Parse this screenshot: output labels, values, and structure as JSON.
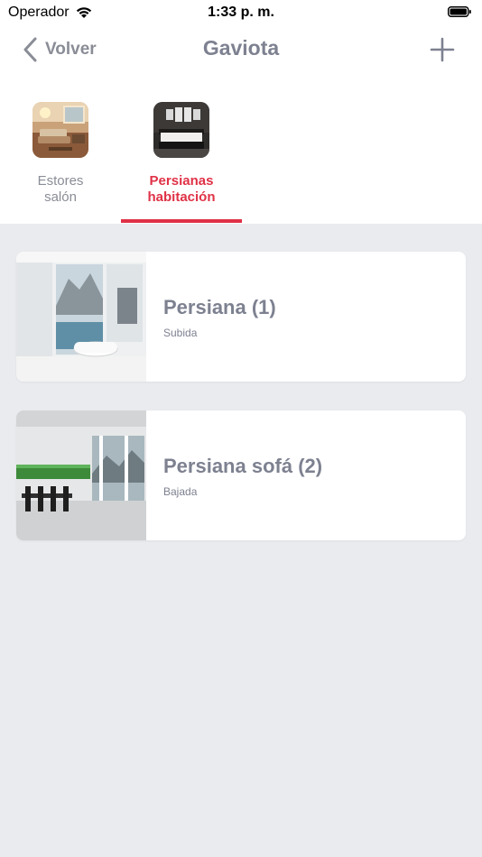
{
  "status_bar": {
    "carrier": "Operador",
    "time": "1:33 p. m."
  },
  "nav": {
    "back_label": "Volver",
    "title": "Gaviota"
  },
  "groups": [
    {
      "label": "Estores\nsalón",
      "active": false
    },
    {
      "label": "Persianas\nhabitación",
      "active": true
    }
  ],
  "devices": [
    {
      "name": "Persiana (1)",
      "status": "Subida"
    },
    {
      "name": "Persiana sofá (2)",
      "status": "Bajada"
    }
  ],
  "colors": {
    "accent": "#e03146",
    "title_gray": "#7d8190",
    "background": "#e9ebef"
  }
}
